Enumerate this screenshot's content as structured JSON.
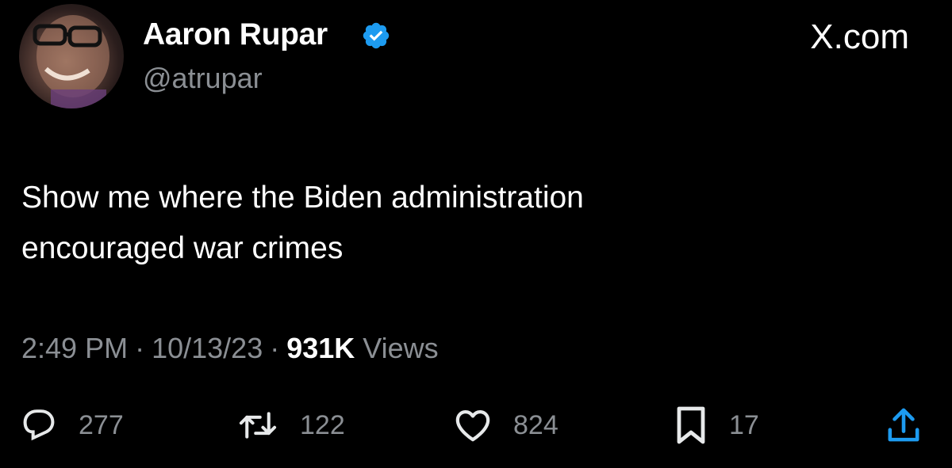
{
  "author": {
    "display_name": "Aaron Rupar",
    "handle": "@atrupar",
    "verified": true,
    "verified_color": "#1d9bf0"
  },
  "site_logo": "X.com",
  "tweet": {
    "lines": [
      "Show me where the Biden administration",
      "encouraged war crimes"
    ]
  },
  "meta": {
    "time": "2:49 PM",
    "separator": "·",
    "date": "10/13/23",
    "views_count": "931K",
    "views_label": "Views"
  },
  "actions": {
    "replies": "277",
    "reposts": "122",
    "likes": "824",
    "bookmarks": "17"
  },
  "icons": {
    "reply": "reply-icon",
    "repost": "repost-icon",
    "like": "heart-icon",
    "bookmark": "bookmark-icon",
    "share": "share-icon",
    "verified": "verified-badge-icon"
  },
  "colors": {
    "background": "#000000",
    "text": "#ffffff",
    "muted": "#8b8f94"
  }
}
